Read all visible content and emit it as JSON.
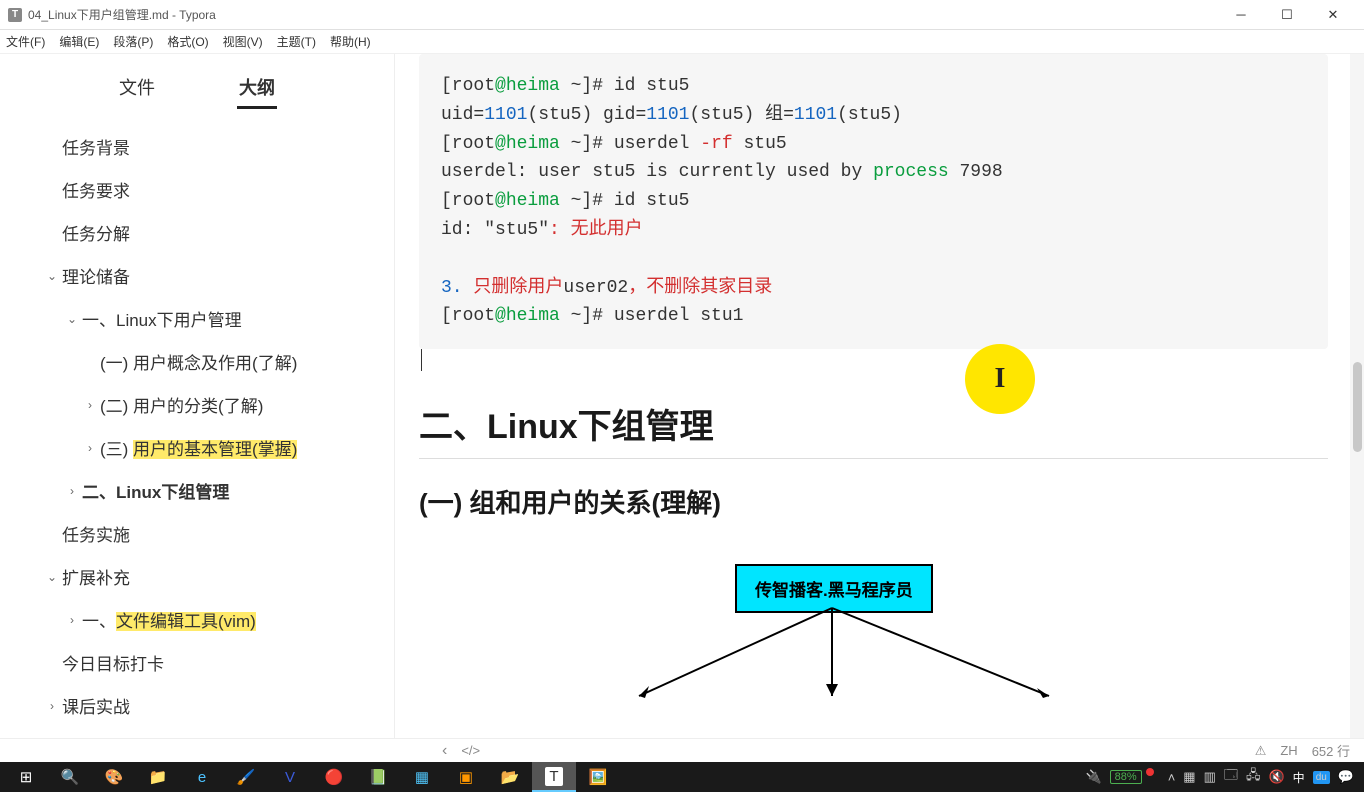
{
  "window": {
    "title": "04_Linux下用户组管理.md - Typora"
  },
  "menus": [
    "文件(F)",
    "编辑(E)",
    "段落(P)",
    "格式(O)",
    "视图(V)",
    "主题(T)",
    "帮助(H)"
  ],
  "sidetabs": {
    "file": "文件",
    "outline": "大纲"
  },
  "outline": {
    "i0": "任务背景",
    "i1": "任务要求",
    "i2": "任务分解",
    "i3": "理论储备",
    "i4": "一、Linux下用户管理",
    "i5": "(一) 用户概念及作用(了解)",
    "i6": "(二) 用户的分类(了解)",
    "i7": "(三) ",
    "i7b": "用户的基本管理(掌握)",
    "i8": "二、Linux下组管理",
    "i9": "任务实施",
    "i10": "扩展补充",
    "i11": "一、",
    "i11b": "文件编辑工具(vim)",
    "i12": "今日目标打卡",
    "i13": "课后实战"
  },
  "code": {
    "l1a": "[root",
    "l1b": "@heima",
    "l1c": " ~]# id stu5",
    "l2a": "uid=",
    "l2b": "1101",
    "l2c": "(stu5) gid=",
    "l2d": "1101",
    "l2e": "(stu5) 组=",
    "l2f": "1101",
    "l2g": "(stu5)",
    "l3a": "[root",
    "l3b": "@heima",
    "l3c": " ~]# userdel ",
    "l3d": "-rf",
    "l3e": " stu5",
    "l4a": "userdel: user stu5 is currently used by ",
    "l4b": "process",
    "l4c": " 7998",
    "l5a": "[root",
    "l5b": "@heima",
    "l5c": " ~]# id stu5",
    "l6a": "id: \"stu5\"",
    "l6b": ": 无此用户",
    "l7a": "3.",
    "l7b": " 只删除用户",
    "l7c": "user02",
    "l7d": "，不删除其家目录",
    "l8a": "[root",
    "l8b": "@heima",
    "l8c": " ~]# userdel stu1"
  },
  "headings": {
    "h2": "二、Linux下组管理",
    "h3": "(一) 组和用户的关系(理解)"
  },
  "diagram": {
    "top": "传智播客.黑马程序员"
  },
  "status": {
    "lang": "ZH",
    "lines": "652 行",
    "breadcrumb_icon": "</>",
    "back": "‹",
    "warn": "⚠"
  },
  "tray": {
    "battery": "88%",
    "ime": "中"
  }
}
